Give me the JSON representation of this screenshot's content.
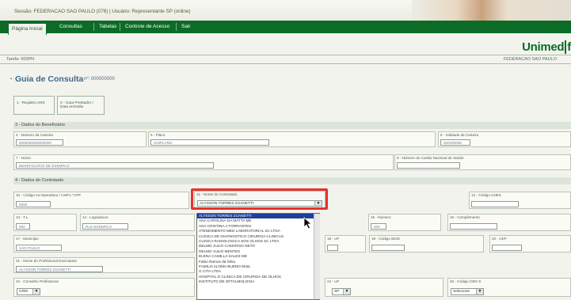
{
  "header": {
    "session_text": "Sessão: FEDERACAO SAO PAULO (076) | Usuário: Representante SP (online)",
    "menu": [
      {
        "label": "Página Inicial",
        "active": true
      },
      {
        "label": "Consultas",
        "active": false
      },
      {
        "label": "Tabelas",
        "active": false
      },
      {
        "label": "Controle de Acesso",
        "active": false
      },
      {
        "label": "Sair",
        "active": false
      }
    ],
    "logo": "Unimed",
    "logo_partial": "f",
    "left_info": "Tarefa: 000PN",
    "right_info": "FEDERACAO SAO PAULO"
  },
  "form": {
    "title": "Guia de Consulta",
    "title_number_label": "nº: 000000000",
    "tab_buttons": [
      {
        "label": "1 - Registro ANS"
      },
      {
        "label": "2 - Guia Prestador / Data emissão"
      }
    ],
    "sections": {
      "beneficiario": "3 - Dados do Beneficiário",
      "contratado": "4 - Dados do Contratado"
    },
    "beneficiario_fields": [
      {
        "label": "4 - Número da Carteira",
        "value": "0000000000000000"
      },
      {
        "label": "5 - Plano",
        "value": "UNIPLANO"
      },
      {
        "label": "6 - Validade da Carteira",
        "value": "00/00/0000"
      },
      {
        "label": "7 - Nome",
        "value": "BENEFICIARIO DE EXEMPLO"
      },
      {
        "label": "8 - Número do Cartão Nacional de Saúde",
        "value": ""
      }
    ],
    "contratado_fields": [
      {
        "label": "10 - Código na Operadora / CNPJ / CPF",
        "value": "0000"
      },
      {
        "label": "11 - Nome do Contratado",
        "value": "ALYSSON TORRES ZUANETTI"
      },
      {
        "label": "12 - Código CNES",
        "value": ""
      },
      {
        "label": "13 - T.L.",
        "value": "000"
      },
      {
        "label": "14 - Logradouro",
        "value": "RUA EXEMPLO"
      },
      {
        "label": "15 - Número",
        "value": "000"
      },
      {
        "label": "16 - Complemento",
        "value": ""
      },
      {
        "label": "17 - Município",
        "value": "SAO PAULO"
      },
      {
        "label": "18 - UF",
        "value": ""
      },
      {
        "label": "19 - Código IBGE",
        "value": ""
      },
      {
        "label": "20 - CEP",
        "value": ""
      },
      {
        "label": "21 - Nome do Profissional Executante",
        "value": "ALYSSON TORRES ZUANETTI"
      },
      {
        "label": "22 - Conselho Profissional",
        "value": "CRM"
      },
      {
        "label": "24 - UF",
        "value": "SP"
      },
      {
        "label": "25 - Código CBO S",
        "value": "Selecione"
      }
    ],
    "contratado_select_value": "ALYSSON TORRES ZUANETTI",
    "dropdown_options": [
      "ALYSSON TORRES ZUANETTI",
      "ANA CAROLINA DA MATTA ME",
      "ANA CRISTINA A TORRANTES",
      "ATENDIMENTO MED LABORATORIAL SC LTDA",
      "CLINICA DE DIAGNOSTICO CIRURGIA CLINICAS",
      "CLINICA RADIOLOGICA SOS OLHOS SC LTDA",
      "DELMO JULIO CAMARGO NETO",
      "DELMO JULIO MENTES",
      "ELENA CAMILLA SALES ME",
      "Fabio Ramos da Silva",
      "FAMILIA ALOMA BUENO Mota",
      "G CITA LTDA",
      "HOSPITAL E CLINICA DE CIRURGIA DE OLHOS",
      "INSTITUTO DE OFTALMOLOGIA"
    ],
    "selected_index": 0
  }
}
